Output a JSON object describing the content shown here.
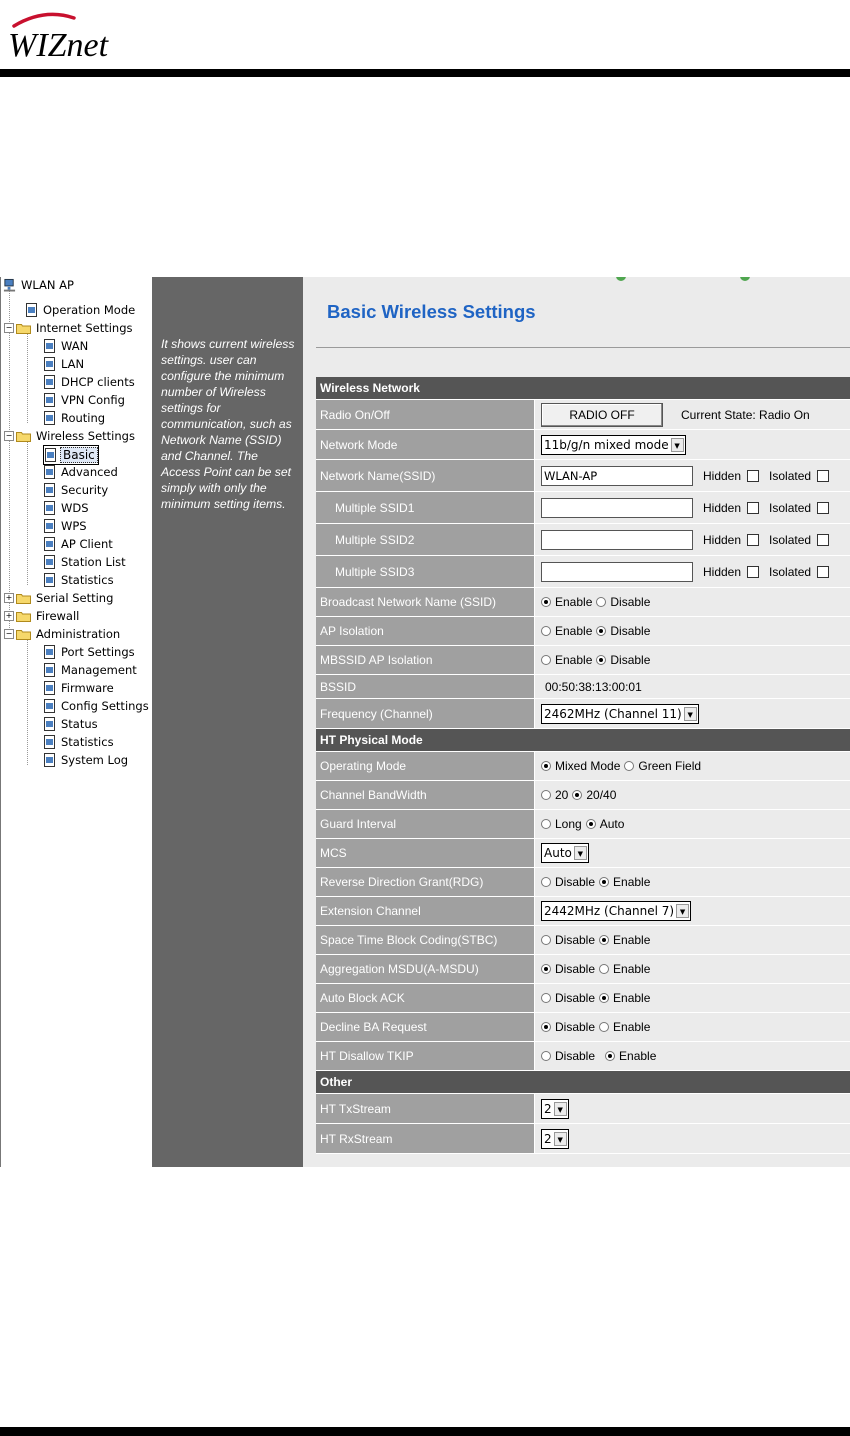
{
  "brand": {
    "logo_text": "WIZnet"
  },
  "tree": {
    "root": "WLAN AP",
    "items": [
      {
        "label": "Operation Mode"
      },
      {
        "label": "Internet Settings"
      },
      {
        "label": "WAN"
      },
      {
        "label": "LAN"
      },
      {
        "label": "DHCP clients"
      },
      {
        "label": "VPN Config"
      },
      {
        "label": "Routing"
      },
      {
        "label": "Wireless Settings"
      },
      {
        "label": "Basic"
      },
      {
        "label": "Advanced"
      },
      {
        "label": "Security"
      },
      {
        "label": "WDS"
      },
      {
        "label": "WPS"
      },
      {
        "label": "AP Client"
      },
      {
        "label": "Station List"
      },
      {
        "label": "Statistics"
      },
      {
        "label": "Serial Setting"
      },
      {
        "label": "Firewall"
      },
      {
        "label": "Administration"
      },
      {
        "label": "Port Settings"
      },
      {
        "label": "Management"
      },
      {
        "label": "Firmware"
      },
      {
        "label": "Config Settings"
      },
      {
        "label": "Status"
      },
      {
        "label": "Statistics"
      },
      {
        "label": "System Log"
      }
    ]
  },
  "help_text": "It shows current wireless settings. user can configure the minimum number of Wireless settings for communication, such as Network Name (SSID) and Channel. The Access Point can be set simply with only the minimum setting items.",
  "page": {
    "title": "Basic Wireless Settings",
    "sections": {
      "wireless": "Wireless Network",
      "ht": "HT Physical Mode",
      "other": "Other"
    },
    "common": {
      "hidden": "Hidden",
      "isolated": "Isolated",
      "enable": "Enable",
      "disable": "Disable"
    },
    "radio": {
      "label": "Radio On/Off",
      "button": "RADIO OFF",
      "state": "Current State: Radio On"
    },
    "network_mode": {
      "label": "Network Mode",
      "value": "11b/g/n mixed mode"
    },
    "ssid": {
      "label": "Network Name(SSID)",
      "value": "WLAN-AP"
    },
    "mssid1": {
      "label": "Multiple SSID1",
      "value": ""
    },
    "mssid2": {
      "label": "Multiple SSID2",
      "value": ""
    },
    "mssid3": {
      "label": "Multiple SSID3",
      "value": ""
    },
    "broadcast": {
      "label": "Broadcast Network Name (SSID)"
    },
    "ap_isolation": {
      "label": "AP Isolation"
    },
    "mbssid_isolation": {
      "label": "MBSSID AP Isolation"
    },
    "bssid": {
      "label": "BSSID",
      "value": "00:50:38:13:00:01"
    },
    "frequency": {
      "label": "Frequency (Channel)",
      "value": "2462MHz (Channel 11)"
    },
    "operating_mode": {
      "label": "Operating Mode",
      "opt1": "Mixed Mode",
      "opt2": "Green Field"
    },
    "bandwidth": {
      "label": "Channel BandWidth",
      "opt1": "20",
      "opt2": "20/40"
    },
    "guard": {
      "label": "Guard Interval",
      "opt1": "Long",
      "opt2": "Auto"
    },
    "mcs": {
      "label": "MCS",
      "value": "Auto"
    },
    "rdg": {
      "label": "Reverse Direction Grant(RDG)"
    },
    "ext_channel": {
      "label": "Extension Channel",
      "value": "2442MHz (Channel 7)"
    },
    "stbc": {
      "label": "Space Time Block Coding(STBC)"
    },
    "amsdu": {
      "label": "Aggregation MSDU(A-MSDU)"
    },
    "auto_ba": {
      "label": "Auto Block ACK"
    },
    "decline_ba": {
      "label": "Decline BA Request"
    },
    "tkip": {
      "label": "HT Disallow TKIP"
    },
    "tx": {
      "label": "HT TxStream",
      "value": "2"
    },
    "rx": {
      "label": "HT RxStream",
      "value": "2"
    }
  }
}
